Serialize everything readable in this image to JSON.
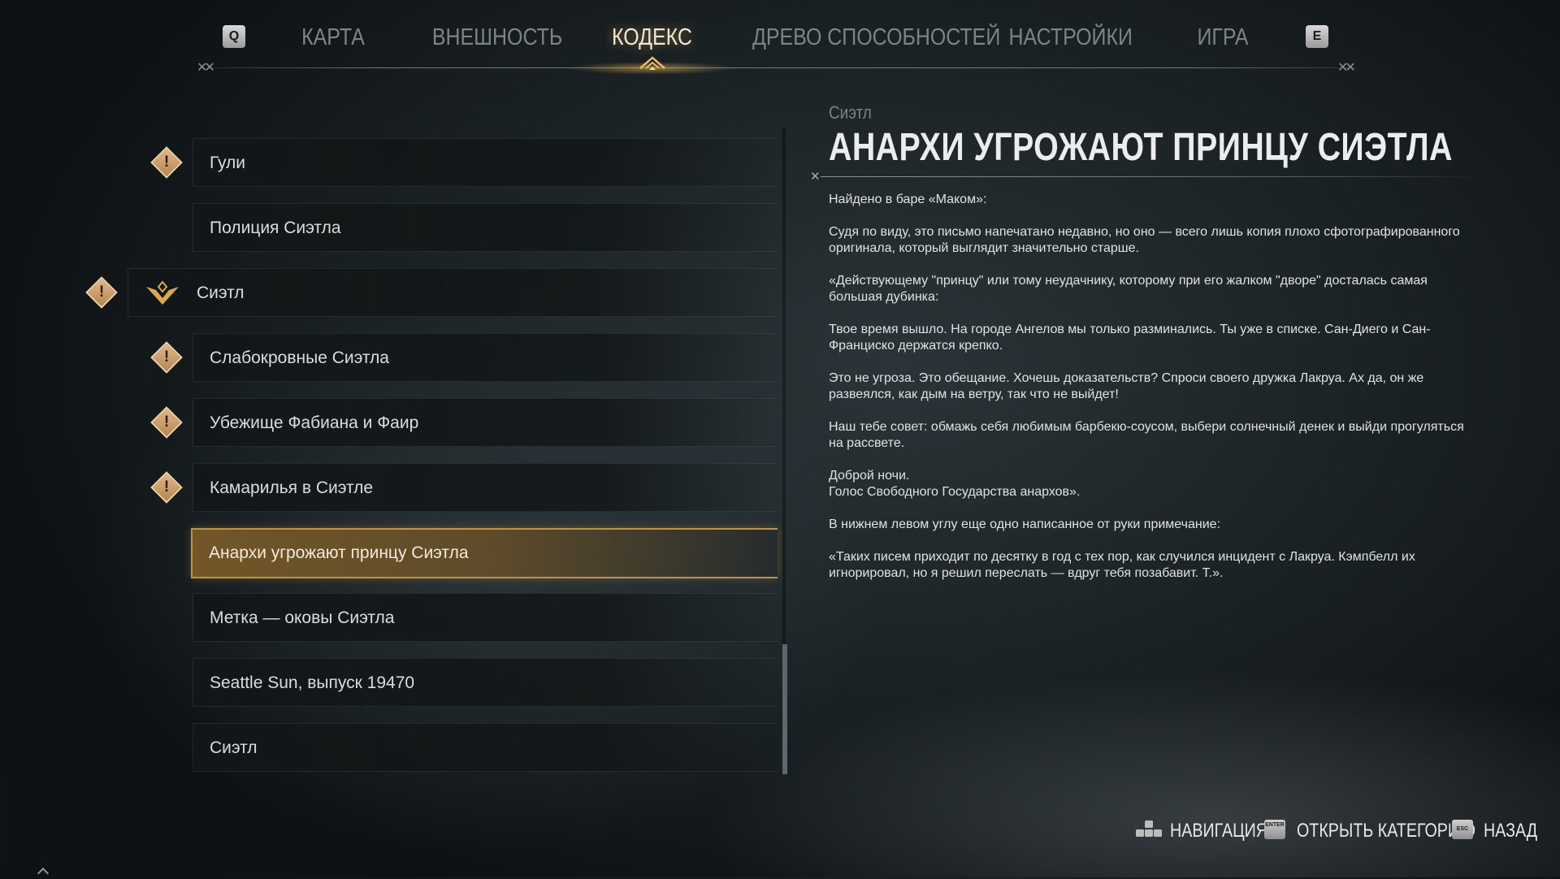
{
  "topnav": {
    "prev_key": "Q",
    "next_key": "E",
    "tabs": [
      {
        "label": "КАРТА",
        "active": false
      },
      {
        "label": "ВНЕШНОСТЬ",
        "active": false
      },
      {
        "label": "КОДЕКС",
        "active": true
      },
      {
        "label": "ДРЕВО СПОСОБНОСТЕЙ",
        "active": false
      },
      {
        "label": "НАСТРОЙКИ",
        "active": false
      },
      {
        "label": "ИГРА",
        "active": false
      }
    ]
  },
  "codex_list": {
    "items": [
      {
        "label": "Гули",
        "badge": "!",
        "kind": "entry"
      },
      {
        "label": "Полиция Сиэтла",
        "badge": "",
        "kind": "entry"
      },
      {
        "label": "Сиэтл",
        "badge": "!",
        "kind": "category"
      },
      {
        "label": "Слабокровные Сиэтла",
        "badge": "!",
        "kind": "entry"
      },
      {
        "label": "Убежище Фабиана и Фаир",
        "badge": "!",
        "kind": "entry"
      },
      {
        "label": "Камарилья в Сиэтле",
        "badge": "!",
        "kind": "entry"
      },
      {
        "label": "Анархи угрожают принцу Сиэтла",
        "badge": "",
        "kind": "selected"
      },
      {
        "label": "Метка — оковы Сиэтла",
        "badge": "",
        "kind": "entry"
      },
      {
        "label": "Seattle Sun, выпуск 19470",
        "badge": "",
        "kind": "entry"
      },
      {
        "label": "Сиэтл",
        "badge": "",
        "kind": "entry"
      }
    ]
  },
  "detail": {
    "category": "Сиэтл",
    "title": "АНАРХИ УГРОЖАЮТ ПРИНЦУ СИЭТЛА",
    "paragraphs": [
      "Найдено в баре «Маком»:",
      "Судя по виду, это письмо напечатано недавно, но оно — всего лишь копия плохо сфотографированного оригинала, который выглядит значительно старше.",
      "«Действующему \"принцу\" или тому неудачнику, которому при его жалком \"дворе\" досталась самая большая дубинка:",
      "Твое время вышло. На городе Ангелов мы только разминались. Ты уже в списке. Сан-Диего и Сан-Франциско держатся крепко.",
      "Это не угроза. Это обещание. Хочешь доказательств? Спроси своего дружка Лакруа. Ах да, он же развеялся, как дым на ветру, так что не выйдет!",
      "Наш тебе совет: обмажь себя любимым барбекю-соусом, выбери солнечный денек и выйди прогуляться на рассвете.",
      "Доброй ночи.\nГолос Свободного Государства анархов».",
      "В нижнем левом углу еще одно написанное от руки примечание:",
      "«Таких писем приходит по десятку в год с тех пор, как случился инцидент с Лакруа. Кэмпбелл их игнорировал, но я решил переслать — вдруг тебя позабавит. Т.»."
    ]
  },
  "footer": {
    "navigation_label": "НАВИГАЦИЯ",
    "open_label": "ОТКРЫТЬ КАТЕГОРИЮ",
    "open_key": "ENTER",
    "back_label": "НАЗАД",
    "back_key": "ESC"
  },
  "colors": {
    "accent_gold": "#b8944f",
    "badge": "#d4a574",
    "tab_inactive": "#7d8488"
  }
}
